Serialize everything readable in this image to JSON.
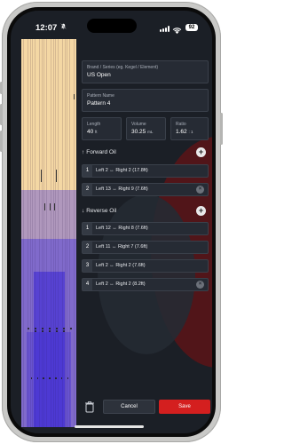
{
  "status_bar": {
    "time": "12:07",
    "battery": "92"
  },
  "form": {
    "brand_series": {
      "label": "Brand / Series (eg. Kegel / Element)",
      "value": "US Open"
    },
    "pattern_name": {
      "label": "Pattern Name",
      "value": "Pattern 4"
    },
    "length": {
      "label": "Length",
      "value": "40",
      "unit": "ft"
    },
    "volume": {
      "label": "Volume",
      "value": "30.25",
      "unit": "mL"
    },
    "ratio": {
      "label": "Ratio",
      "value": "1.62",
      "unit": ": 1"
    }
  },
  "forward_oil": {
    "title": "Forward Oil",
    "arrow": "↑",
    "rows": [
      {
        "num": "1",
        "text": "Left 2 ↔ Right 2 (17.8ft)"
      },
      {
        "num": "2",
        "text": "Left 13 ↔ Right 9 (7.6ft)"
      }
    ]
  },
  "reverse_oil": {
    "title": "Reverse Oil",
    "arrow": "↓",
    "rows": [
      {
        "num": "1",
        "text": "Left 12 ↔ Right 8 (7.6ft)"
      },
      {
        "num": "2",
        "text": "Left 11 ↔ Right 7 (7.6ft)"
      },
      {
        "num": "3",
        "text": "Left 2 ↔ Right 2 (7.6ft)"
      },
      {
        "num": "4",
        "text": "Left 2 ↔ Right 2 (8.2ft)"
      }
    ]
  },
  "actions": {
    "cancel": "Cancel",
    "save": "Save"
  },
  "icons": {
    "add": "plus-icon",
    "remove": "close-icon",
    "delete": "trash-icon",
    "wifi": "wifi-icon",
    "signal": "signal-icon",
    "bell": "bell-icon"
  },
  "colors": {
    "background": "#1b1f26",
    "field": "#262b34",
    "save": "#d41f1f",
    "accent_bg": "#5a1418"
  }
}
